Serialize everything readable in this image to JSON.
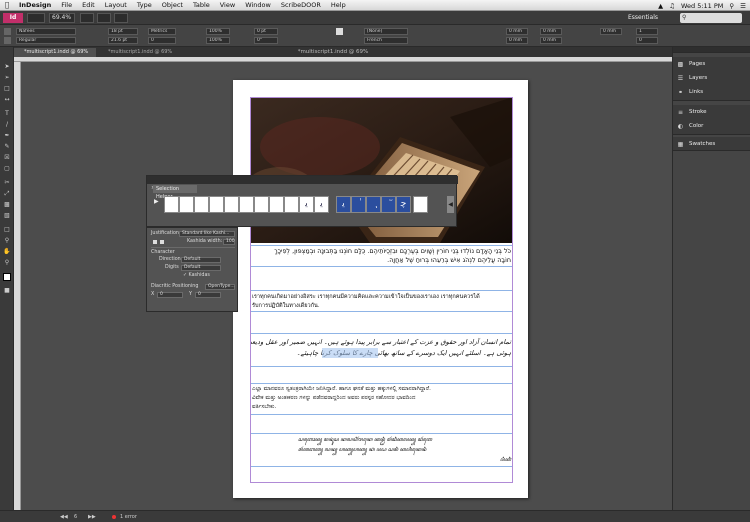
{
  "menubar": {
    "apple_icon": "apple-icon",
    "app_name": "InDesign",
    "items": [
      "File",
      "Edit",
      "Layout",
      "Type",
      "Object",
      "Table",
      "View",
      "Window",
      "ScribeDOOR",
      "Help"
    ],
    "clock": "Wed 5:11 PM"
  },
  "appbar": {
    "logo": "Id",
    "zoom": "69.4%",
    "workspace": "Essentials"
  },
  "control": {
    "font_family": "Nafees",
    "font_style": "Regular",
    "size": "18 pt",
    "leading": "21.6 pt",
    "kerning": "Metrics",
    "tracking": "0",
    "scale_v": "100%",
    "scale_h": "100%",
    "baseline": "0 pt",
    "skew": "0°",
    "char_style": "[None]",
    "language": "Arabic",
    "lang2": "French",
    "indent1": "0 mm",
    "indent2": "0 mm",
    "indent3": "0 mm",
    "indent4": "0 mm",
    "indent5": "0 mm",
    "columns": "1",
    "para_style": "0"
  },
  "tabs": {
    "tab1": "*multiscript1.indd @ 69%",
    "tab2": "*multiscript1.indd @ 69%",
    "window_title": "*multiscript1.indd @ 69%"
  },
  "document": {
    "hebrew": "כֹּל בְּנֵי הָאָדָם נוֹלְדוּ בְּנֵי חוֹרִין וְשָׁוִים בְּעֶרְכָּם וּבִזְכֻיּוֹתֵיהֶם. כֻּלָּם חוֹנְנוּ בַּתְּבוּנָה וּבְמַצְפּוּן, לְפִיכָךְ",
    "hebrew2": "חוֹבָה עֲלֵיהֶם לִנְהֹג אִישׁ בְּרֵעֵהוּ בְּרוּחַ שֶׁל אַחֲוָה.",
    "thai": "เราทุกคนเกิดมาอย่างอิสระ เราทุกคนมีความคิดและความเข้าใจเป็นของเราเอง เราทุกคนควรได้",
    "thai2": "รับการปฏิบัติในทางเดียวกัน.",
    "urdu": "تمام انسان آزاد اور حقوق و عزت کے اعتبار سے برابر پیدا ہوئے ہیں۔ انہیں ضمیر اور عقل ودیعت",
    "urdu2": "ہوئی ہے۔ اسلئے انہیں ایک دوسرے کے ساتھ بھائی چارے کا سلوک کرنا چاہیئے۔",
    "kannada": "ಎಲ್ಲಾ ಮಾನವರೂ ಸ್ವತಂತ್ರರಾಗಿಯೇ ಜನಿಸಿದ್ದಾರೆ. ಹಾಗೂ ಘನತೆ ಮತ್ತು ಹಕ್ಕುಗಳಲ್ಲಿ ಸಮಾನರಾಗಿದ್ದಾರೆ.",
    "kannada2": "ವಿವೇಕ ಮತ್ತು ಅಂತಃಕರಣ ಗಳನ್ನು ಪಡೆದವರಾದ್ದರಿಂದ ಅವರು ಪರಸ್ಪರ ಸಹೋದರ ಭಾವದಿಂದ",
    "kannada3": "ವರ್ತಿಸಬೇಕು.",
    "script1": "ꦱꦧꦺꦴꦤ꧀ ꦩꦤꦸꦁꦱ ꦏꦭꦲꦶꦂꦫꦏꦺ ꦏꦤ꧀ꦛꦶ ꦩꦂꦢꦶꦏꦭꦤ꧀ ꦢꦂꦧꦺ",
    "script2": "ꦩꦂꦠꦧꦠ꧀ ꦭꦤ꧀ ꦲꦏ꧀‌ꦲꦏ꧀ ꦏꦁ ꦥꦝ ꦱꦩꦶ ꦏꦲꦶꦏꦺꦤꦶ",
    "script3": "ꦥꦶꦏꦶꦫꦤ꧀"
  },
  "panel": {
    "title": "Selection Helper",
    "close": "×",
    "glyphs": [
      "",
      "",
      "",
      "",
      "",
      "",
      "",
      "",
      "",
      "ﻳ",
      "ﻳ",
      "",
      "ﯾ",
      "ٰ",
      "ٖ",
      "ٓ",
      "ﭼ",
      ""
    ],
    "selected_index": [
      11,
      12,
      13,
      14,
      15,
      16
    ],
    "justification_label": "Justification",
    "justification_value": "Standard like Kashi...",
    "kashida_label": "Kashida width:",
    "kashida_value": "100",
    "character_label": "Character",
    "direction_label": "Direction",
    "direction_value": "Default",
    "digits_label": "Digits",
    "digits_value": "Default",
    "kashidas_label": "Kashidas",
    "diacritic_label": "Diacritic Positioning",
    "diacritic_value": "OpenType...",
    "x_value": "0",
    "y_value": "0"
  },
  "dock": {
    "pages": "Pages",
    "layers": "Layers",
    "links": "Links",
    "stroke": "Stroke",
    "color": "Color",
    "swatches": "Swatches"
  },
  "status": {
    "page": "6",
    "errors": "1 error"
  },
  "colors": {
    "indesign_pink": "#c22f6a",
    "selection_blue": "#2b4e9e",
    "frame_guide": "#8fb4e6",
    "margin_guide": "#b08ad6"
  }
}
